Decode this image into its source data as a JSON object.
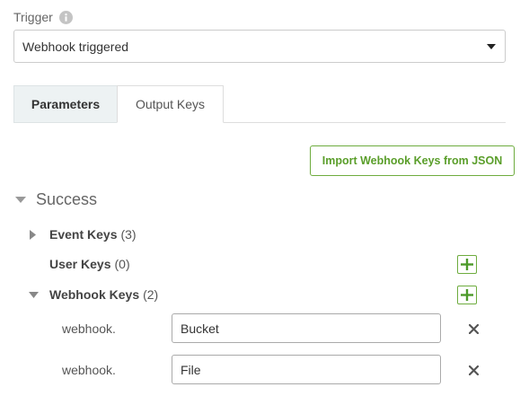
{
  "trigger": {
    "label": "Trigger",
    "info_icon": "info-icon",
    "selected": "Webhook triggered"
  },
  "tabs": [
    {
      "label": "Parameters",
      "state": "inactive"
    },
    {
      "label": "Output Keys",
      "state": "active"
    }
  ],
  "import_button": {
    "label": "Import Webhook Keys from JSON"
  },
  "success": {
    "label": "Success",
    "groups": [
      {
        "name": "Event Keys",
        "count": "(3)",
        "expanded": false
      },
      {
        "name": "User Keys",
        "count": "(0)"
      },
      {
        "name": "Webhook Keys",
        "count": "(2)",
        "expanded": true
      }
    ],
    "webhook_keys": [
      {
        "prefix": "webhook.",
        "value": "Bucket"
      },
      {
        "prefix": "webhook.",
        "value": "File"
      }
    ]
  },
  "colors": {
    "accent_green": "#6eac3e",
    "tab_inactive_bg": "#edf2f3",
    "border": "#cccccc"
  }
}
